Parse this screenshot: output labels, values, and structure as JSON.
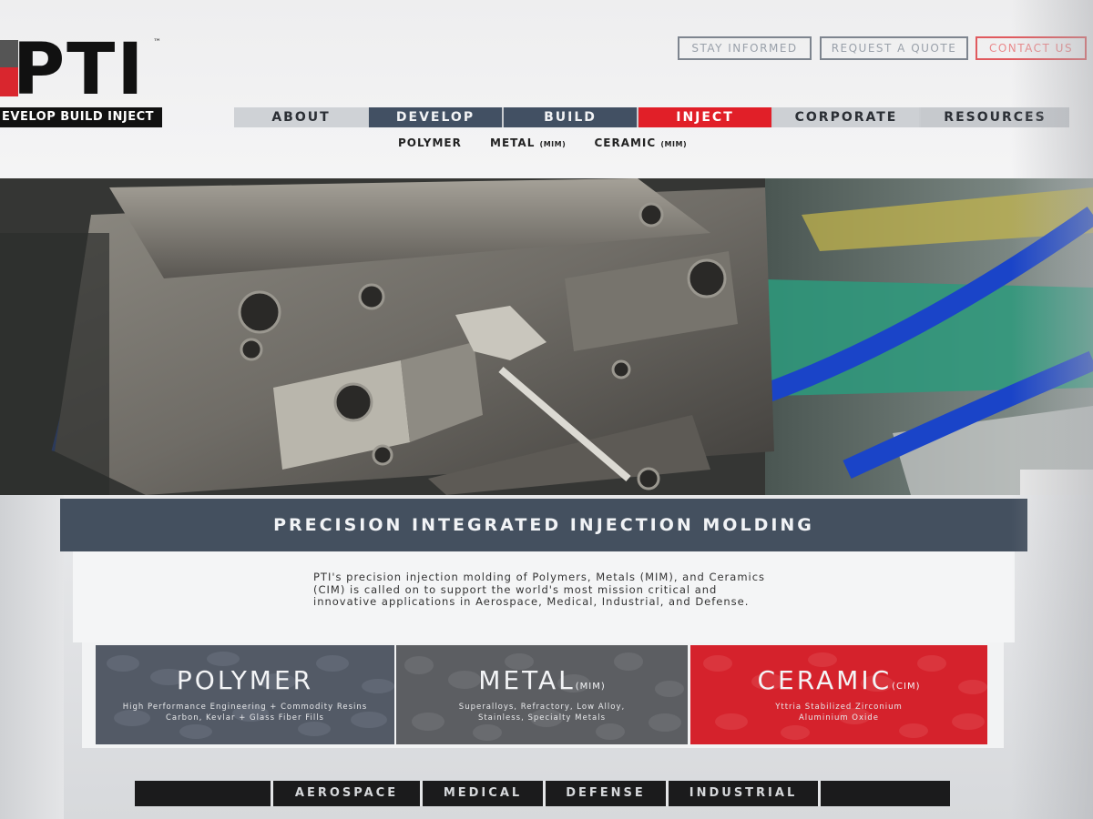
{
  "logo": {
    "name": "PTI",
    "trademark": "™",
    "tagline": "EVELOP BUILD INJECT"
  },
  "utility": {
    "stay_informed": "STAY INFORMED",
    "request_quote": "REQUEST A QUOTE",
    "contact_us": "CONTACT US"
  },
  "nav": {
    "items": [
      {
        "label": "ABOUT"
      },
      {
        "label": "DEVELOP"
      },
      {
        "label": "BUILD"
      },
      {
        "label": "INJECT"
      },
      {
        "label": "CORPORATE"
      },
      {
        "label": "RESOURCES"
      }
    ]
  },
  "subnav": {
    "polymer": "POLYMER",
    "metal": "METAL",
    "metal_suffix": "(MIM)",
    "ceramic": "CERAMIC",
    "ceramic_suffix": "(MIM)"
  },
  "banner": {
    "title": "PRECISION INTEGRATED INJECTION MOLDING"
  },
  "description": "PTI's precision injection molding of Polymers, Metals (MIM), and Ceramics (CIM) is called on to support the world's most mission critical and innovative applications in Aerospace, Medical, Industrial, and Defense.",
  "tiles": {
    "polymer": {
      "title": "POLYMER",
      "line1": "High Performance Engineering + Commodity Resins",
      "line2": "Carbon, Kevlar + Glass Fiber Fills"
    },
    "metal": {
      "title": "METAL",
      "suffix": "(MIM)",
      "line1": "Superalloys, Refractory, Low Alloy,",
      "line2": "Stainless, Specialty Metals"
    },
    "ceramic": {
      "title": "CERAMIC",
      "suffix": "(CIM)",
      "line1": "Yttria Stabilized Zirconium",
      "line2": "Aluminium Oxide"
    }
  },
  "industries": {
    "aerospace": "AEROSPACE",
    "medical": "MEDICAL",
    "defense": "DEFENSE",
    "industrial": "INDUSTRIAL"
  },
  "colors": {
    "accent_red": "#e11f28",
    "nav_blue": "#425063",
    "banner_blue": "#44505f"
  },
  "hero_icon": "injection-mold-photo"
}
